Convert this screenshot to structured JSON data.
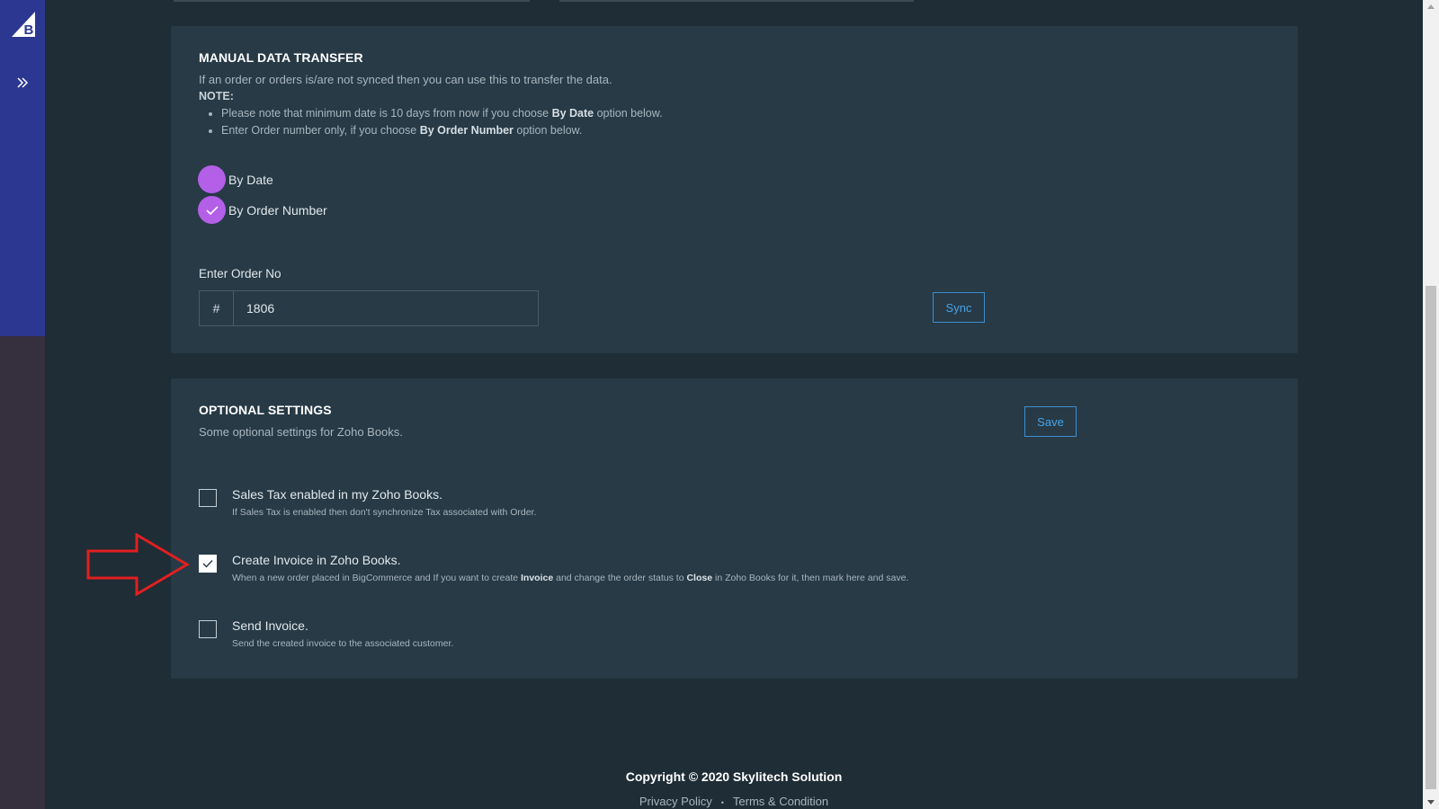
{
  "sidebar": {
    "logo_icon": "bigcommerce-logo-icon",
    "expand_icon": "double-chevron-right-icon"
  },
  "manual_transfer": {
    "title": "MANUAL DATA TRANSFER",
    "description": "If an order or orders is/are not synced then you can use this to transfer the data.",
    "note_label": "NOTE:",
    "bullet_1_pre": "Please note that minimum date is 10 days from now if you choose ",
    "bullet_1_bold": "By Date",
    "bullet_1_post": " option below.",
    "bullet_2_pre": "Enter Order number only, if you choose ",
    "bullet_2_bold": "By Order Number",
    "bullet_2_post": " option below.",
    "radio_by_date": "By Date",
    "radio_by_order": "By Order Number",
    "selected_option": "By Order Number",
    "order_label": "Enter Order No",
    "order_prefix": "#",
    "order_value": "1806",
    "sync_label": "Sync"
  },
  "optional_settings": {
    "title": "OPTIONAL SETTINGS",
    "description": "Some optional settings for Zoho Books.",
    "save_label": "Save",
    "sales_tax_title": "Sales Tax enabled in my Zoho Books.",
    "sales_tax_desc": "If Sales Tax is enabled then don't synchronize Tax associated with Order.",
    "sales_tax_checked": false,
    "create_invoice_title": "Create Invoice in Zoho Books.",
    "create_invoice_desc_1": "When a new order placed in BigCommerce and If you want to create ",
    "create_invoice_desc_b1": "Invoice",
    "create_invoice_desc_2": " and change the order status to ",
    "create_invoice_desc_b2": "Close",
    "create_invoice_desc_3": " in Zoho Books for it, then mark here and save.",
    "create_invoice_checked": true,
    "send_invoice_title": "Send Invoice.",
    "send_invoice_desc": "Send the created invoice to the associated customer.",
    "send_invoice_checked": false
  },
  "annotation": {
    "arrow_color": "#e02020"
  },
  "footer": {
    "copyright": "Copyright © 2020 Skylitech Solution",
    "privacy": "Privacy Policy",
    "separator": "•",
    "terms": "Terms & Condition"
  },
  "colors": {
    "accent_purple": "#b45fe8",
    "button_blue": "#3e8ed0",
    "sidebar_blue": "#2c3791"
  }
}
